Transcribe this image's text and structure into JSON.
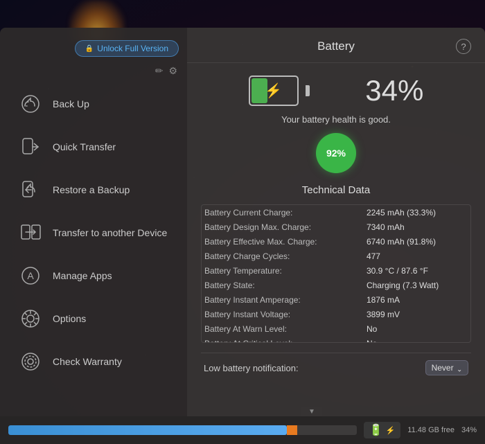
{
  "app": {
    "title": "Battery",
    "help_label": "?"
  },
  "header": {
    "unlock_label": "Unlock Full Version",
    "lock_icon": "🔒"
  },
  "toolbar": {
    "edit_icon": "✏️",
    "gear_icon": "⚙️"
  },
  "nav": {
    "items": [
      {
        "id": "back-up",
        "label": "Back Up",
        "icon": "backup"
      },
      {
        "id": "quick-transfer",
        "label": "Quick Transfer",
        "icon": "transfer"
      },
      {
        "id": "restore-backup",
        "label": "Restore a Backup",
        "icon": "restore"
      },
      {
        "id": "transfer-device",
        "label": "Transfer to another Device",
        "icon": "device"
      },
      {
        "id": "manage-apps",
        "label": "Manage Apps",
        "icon": "apps"
      },
      {
        "id": "options",
        "label": "Options",
        "icon": "options"
      },
      {
        "id": "check-warranty",
        "label": "Check Warranty",
        "icon": "warranty"
      }
    ]
  },
  "battery": {
    "percent": "34%",
    "health_text": "Your battery health is good.",
    "health_percent": "92%",
    "section_title": "Technical Data",
    "fill_percent": 34
  },
  "technical_data": {
    "rows": [
      {
        "label": "Battery Current Charge:",
        "value": "2245 mAh (33.3%)"
      },
      {
        "label": "Battery Design Max. Charge:",
        "value": "7340 mAh"
      },
      {
        "label": "Battery Effective Max. Charge:",
        "value": "6740 mAh (91.8%)"
      },
      {
        "label": "Battery Charge Cycles:",
        "value": "477"
      },
      {
        "label": "Battery Temperature:",
        "value": "30.9 °C / 87.6 °F"
      },
      {
        "label": "Battery State:",
        "value": "Charging (7.3 Watt)"
      },
      {
        "label": "Battery Instant Amperage:",
        "value": "1876 mA"
      },
      {
        "label": "Battery Instant Voltage:",
        "value": "3899 mV"
      },
      {
        "label": "Battery At Warn Level:",
        "value": "No"
      },
      {
        "label": "Battery At Critical Level:",
        "value": "No"
      }
    ]
  },
  "notification": {
    "label": "Low battery notification:",
    "value": "Never",
    "chevron": "⌃"
  },
  "bottom_bar": {
    "storage_text": "11.48 GB free",
    "storage_percent": "34%",
    "battery_icon": "🔋"
  }
}
